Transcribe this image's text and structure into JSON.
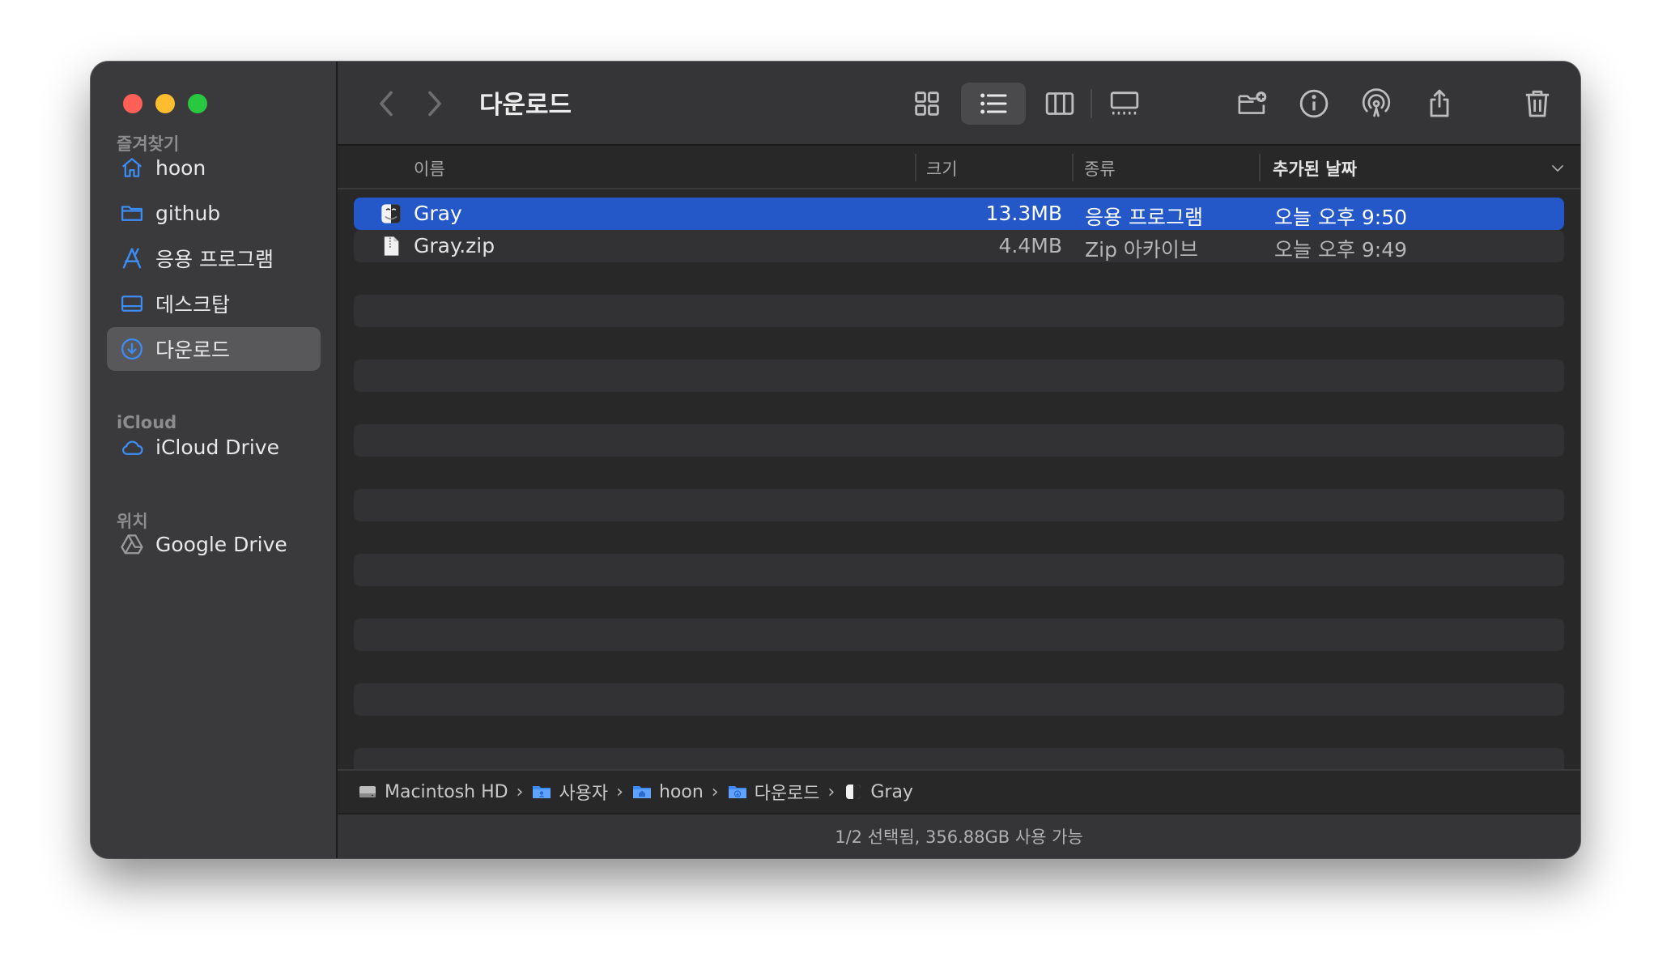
{
  "window": {
    "title": "다운로드"
  },
  "sidebar": {
    "sections": [
      {
        "label": "즐겨찾기",
        "items": [
          {
            "label": "hoon",
            "icon": "home-icon"
          },
          {
            "label": "github",
            "icon": "folder-icon"
          },
          {
            "label": "응용 프로그램",
            "icon": "applications-icon"
          },
          {
            "label": "데스크탑",
            "icon": "desktop-icon"
          },
          {
            "label": "다운로드",
            "icon": "download-icon",
            "selected": true
          }
        ]
      },
      {
        "label": "iCloud",
        "items": [
          {
            "label": "iCloud Drive",
            "icon": "cloud-icon"
          }
        ]
      },
      {
        "label": "위치",
        "items": [
          {
            "label": "Google Drive",
            "icon": "google-drive-icon"
          }
        ]
      }
    ]
  },
  "toolbar": {
    "buttons": [
      "back-icon",
      "forward-icon",
      "icon-view-icon",
      "list-view-icon",
      "column-view-icon",
      "gallery-view-icon",
      "new-folder-icon",
      "info-icon",
      "airdrop-icon",
      "share-icon",
      "trash-icon",
      "search-icon"
    ],
    "active_view": "list"
  },
  "columns": {
    "name": "이름",
    "size": "크기",
    "kind": "종류",
    "date_added": "추가된 날짜"
  },
  "files": [
    {
      "name": "Gray",
      "size": "13.3MB",
      "kind": "응용 프로그램",
      "date_added": "오늘 오후 9:50",
      "selected": true,
      "icon": "app-icon"
    },
    {
      "name": "Gray.zip",
      "size": "4.4MB",
      "kind": "Zip 아카이브",
      "date_added": "오늘 오후 9:49",
      "selected": false,
      "icon": "zip-file-icon"
    }
  ],
  "pathbar": [
    {
      "label": "Macintosh HD",
      "icon": "disk-icon"
    },
    {
      "label": "사용자",
      "icon": "folder-icon"
    },
    {
      "label": "hoon",
      "icon": "home-folder-icon"
    },
    {
      "label": "다운로드",
      "icon": "download-folder-icon"
    },
    {
      "label": "Gray",
      "icon": "app-icon"
    }
  ],
  "status": "1/2 선택됨, 356.88GB 사용 가능",
  "colors": {
    "accent": "#2457c8",
    "sidebar_icon": "#3d8cf5",
    "close": "#fe5f57",
    "minimize": "#febc2e",
    "zoom": "#28c840"
  }
}
